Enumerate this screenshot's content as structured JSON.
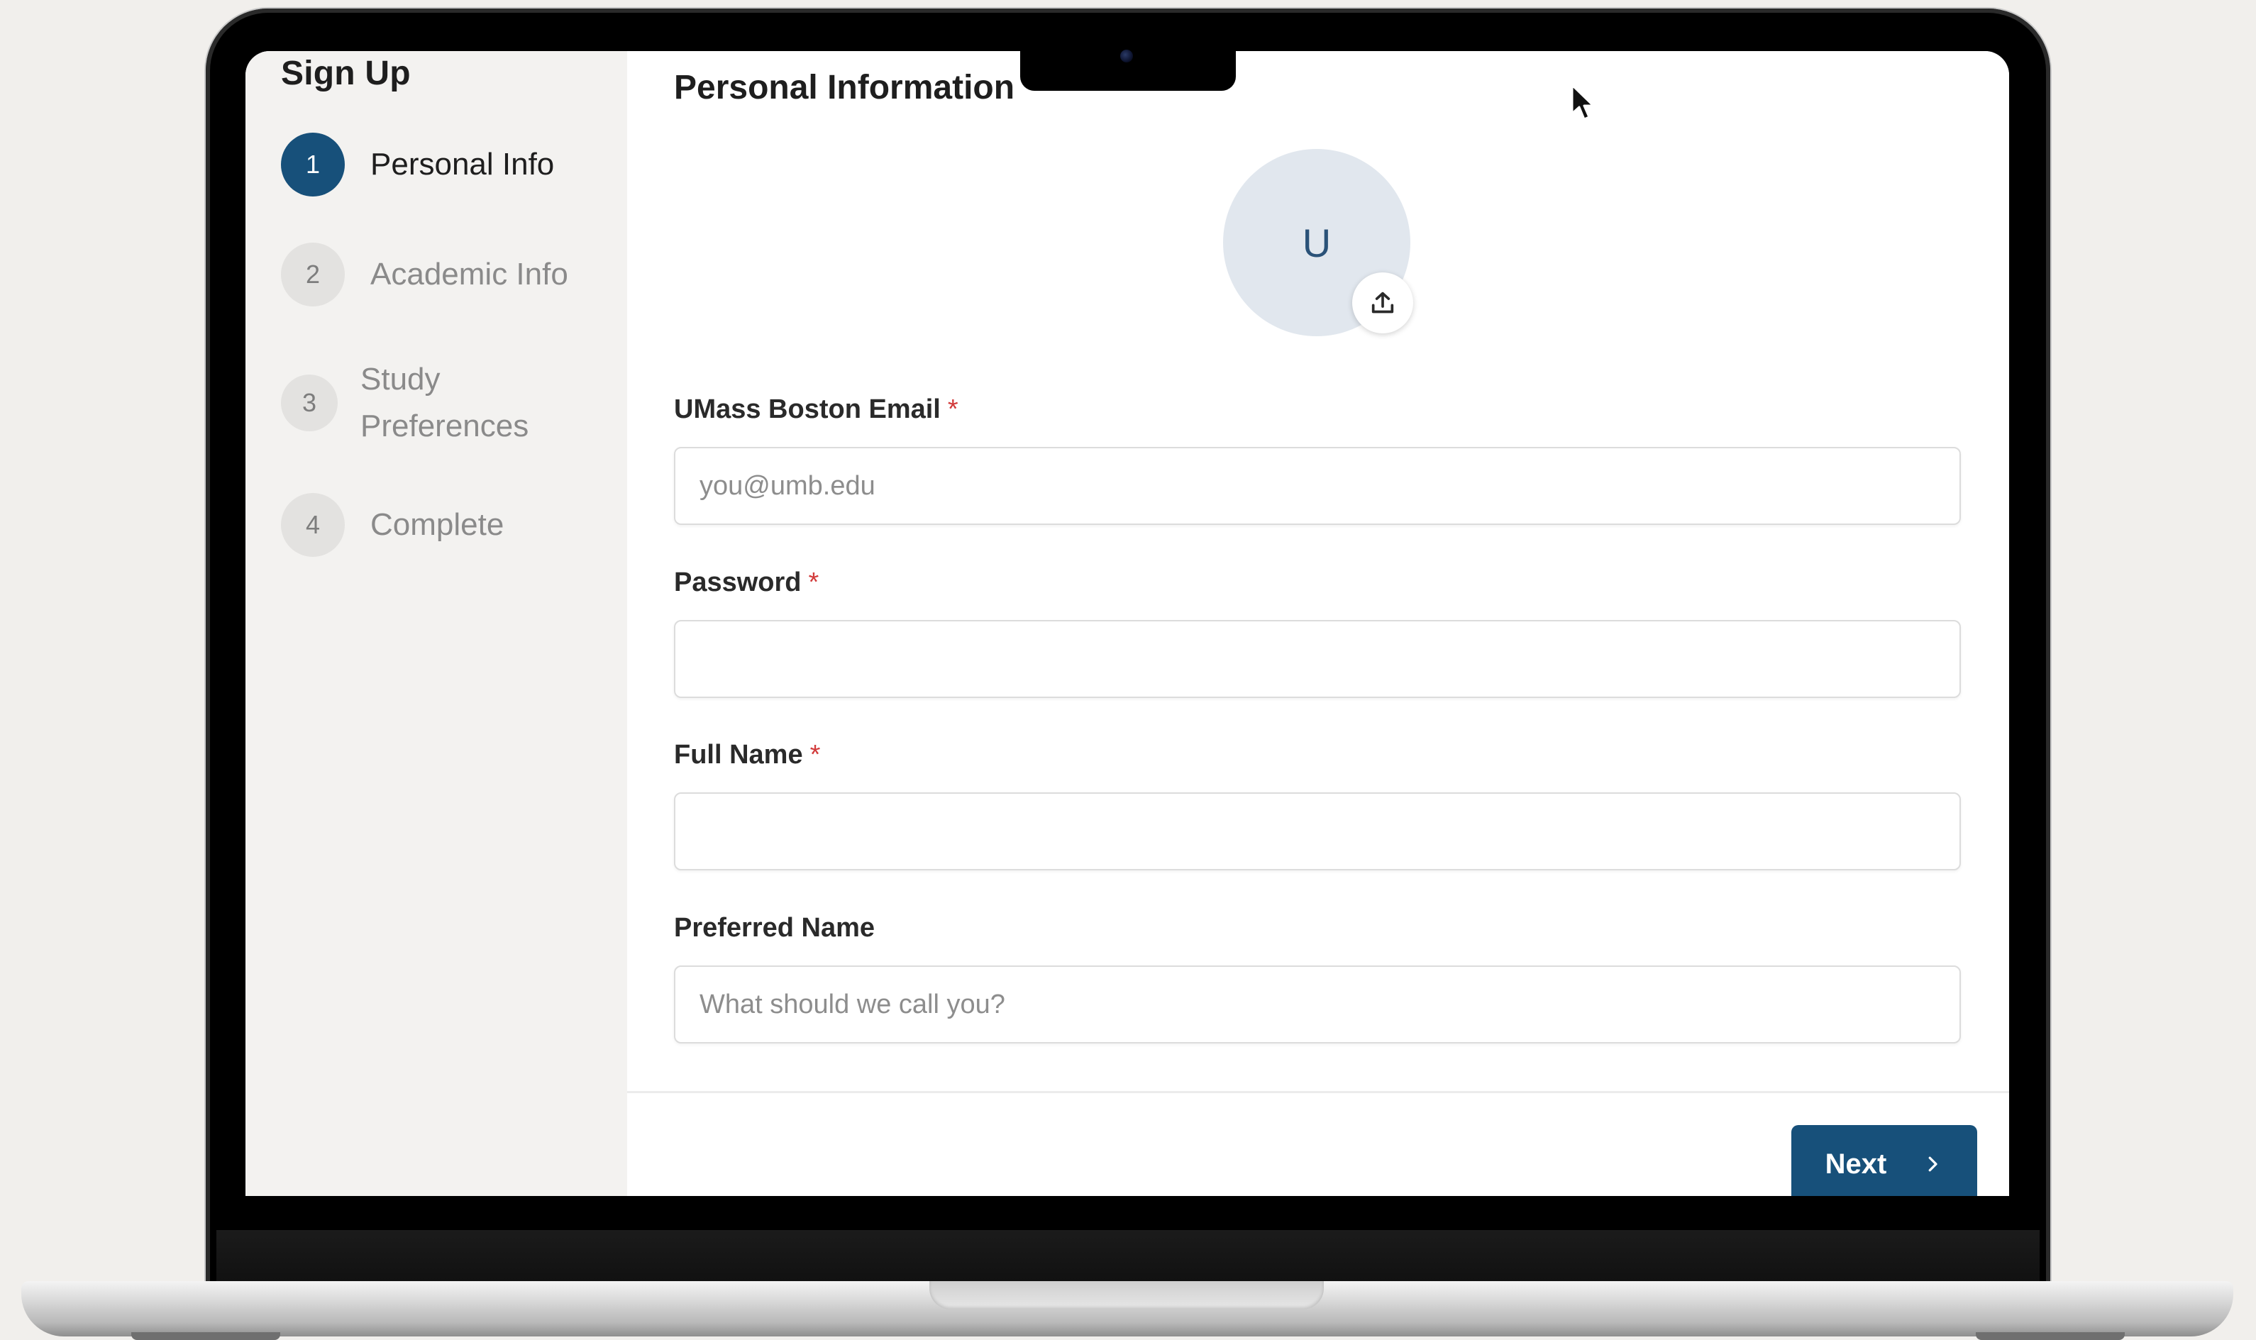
{
  "sidebar": {
    "title": "Sign Up",
    "steps": [
      {
        "number": "1",
        "label": "Personal Info",
        "state": "active"
      },
      {
        "number": "2",
        "label": "Academic Info",
        "state": "inactive"
      },
      {
        "number": "3",
        "label": "Study Preferences",
        "state": "inactive"
      },
      {
        "number": "4",
        "label": "Complete",
        "state": "inactive"
      }
    ]
  },
  "main": {
    "title": "Personal Information",
    "avatar": {
      "initial": "U",
      "upload_icon": "upload-icon"
    },
    "fields": {
      "email": {
        "label": "UMass Boston Email",
        "required": "*",
        "placeholder": "you@umb.edu",
        "value": ""
      },
      "password": {
        "label": "Password",
        "required": "*",
        "placeholder": "",
        "value": ""
      },
      "full_name": {
        "label": "Full Name",
        "required": "*",
        "placeholder": "",
        "value": ""
      },
      "preferred_name": {
        "label": "Preferred Name",
        "placeholder": "What should we call you?",
        "value": ""
      }
    },
    "next_button": {
      "label": "Next",
      "icon": "chevron-right-icon"
    }
  },
  "colors": {
    "accent": "#17507a",
    "required": "#d23b3b",
    "sidebar_bg": "#f3f2f0",
    "avatar_bg": "#e1e7ee"
  }
}
